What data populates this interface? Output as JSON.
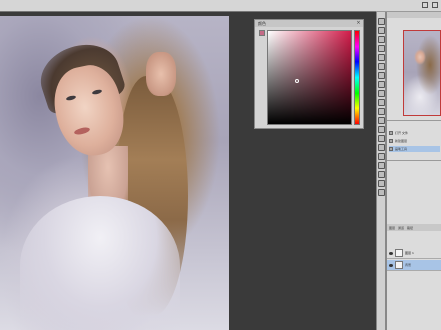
{
  "app": {
    "window_controls": [
      "minimize",
      "maximize",
      "close"
    ]
  },
  "color_picker": {
    "title": "颜色",
    "close_label": "×",
    "current_color": "#c46a86",
    "hue_color": "#d21c4a"
  },
  "tools": [
    "move-tool-icon",
    "marquee-tool-icon",
    "lasso-tool-icon",
    "magic-wand-icon",
    "crop-tool-icon",
    "eyedropper-icon",
    "healing-brush-icon",
    "brush-tool-icon",
    "clone-stamp-icon",
    "history-brush-icon",
    "eraser-icon",
    "gradient-tool-icon",
    "blur-tool-icon",
    "dodge-tool-icon",
    "pen-tool-icon",
    "type-tool-icon",
    "path-select-icon",
    "shape-tool-icon",
    "hand-tool-icon",
    "zoom-tool-icon"
  ],
  "right_panel": {
    "history": [
      {
        "label": "打开 文件",
        "selected": false
      },
      {
        "label": "新建图层",
        "selected": false
      },
      {
        "label": "画笔工具",
        "selected": true
      }
    ],
    "layers_tabs": [
      "图层",
      "通道",
      "路径"
    ],
    "layers": [
      {
        "name": "图层 1",
        "active": false
      },
      {
        "name": "背景",
        "active": true
      }
    ]
  }
}
